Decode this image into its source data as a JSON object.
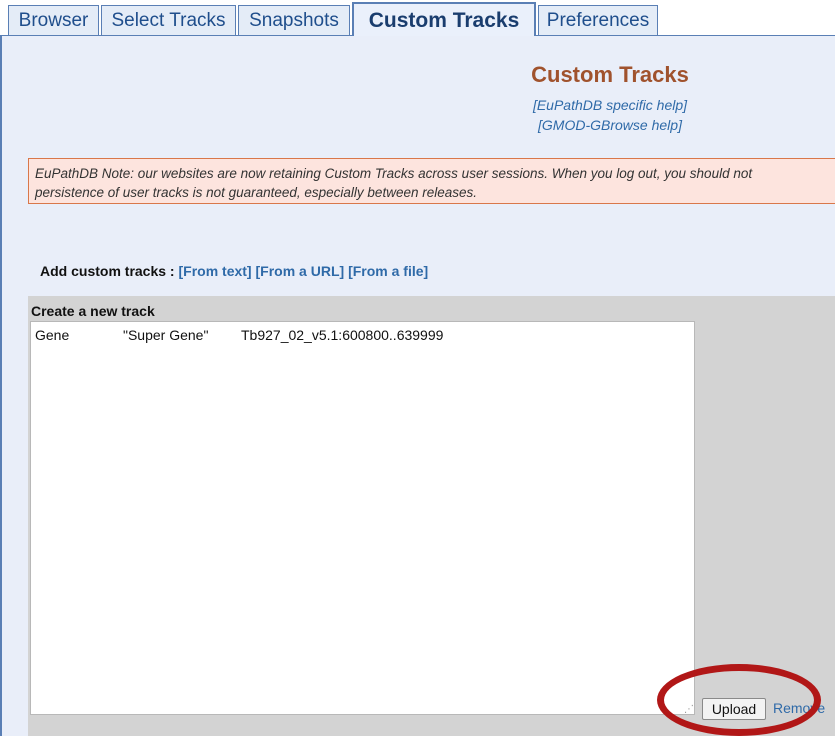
{
  "tabs": [
    {
      "label": "Browser",
      "active": false
    },
    {
      "label": "Select Tracks",
      "active": false
    },
    {
      "label": "Snapshots",
      "active": false
    },
    {
      "label": "Custom Tracks",
      "active": true
    },
    {
      "label": "Preferences",
      "active": false
    }
  ],
  "header": {
    "title": "Custom Tracks",
    "help_links": [
      "[EuPathDB specific help]",
      "[GMOD-GBrowse help]"
    ]
  },
  "note": {
    "line1": "EuPathDB Note: our websites are now retaining Custom Tracks across user sessions. When you log out, you should not",
    "line2": "persistence of user tracks is not guaranteed, especially between releases."
  },
  "add_tracks": {
    "label": "Add custom tracks :",
    "options": [
      "[From text]",
      "[From a URL]",
      "[From a file]"
    ]
  },
  "new_track": {
    "label": "Create a new track",
    "content": {
      "type": "Gene",
      "name": "\"Super Gene\"",
      "location": "Tb927_02_v5.1:600800..639999"
    },
    "upload_label": "Upload",
    "remove_label": "Remove"
  },
  "colors": {
    "title": "#a0522d",
    "link": "#2f6aa8",
    "tab_border": "#5a7fb5",
    "note_bg": "#fde4de",
    "highlight": "#b11717"
  }
}
